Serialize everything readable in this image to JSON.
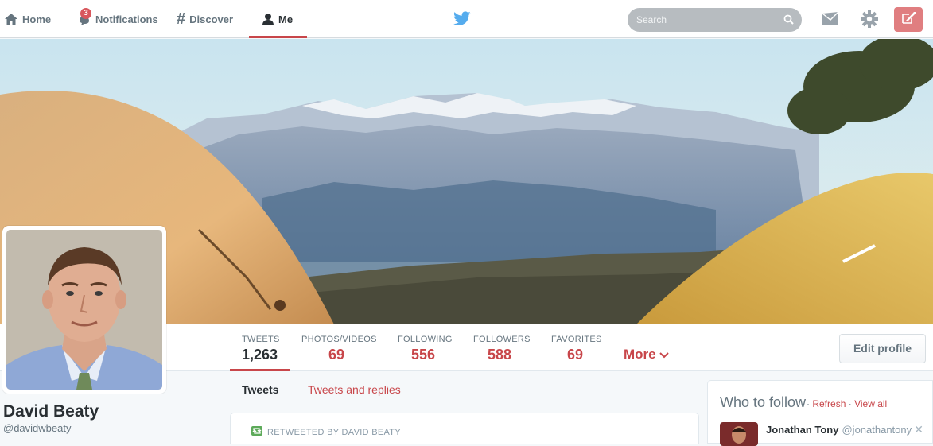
{
  "nav": {
    "home_label": "Home",
    "notifications_label": "Notifications",
    "notifications_count": "3",
    "discover_label": "Discover",
    "me_label": "Me"
  },
  "search": {
    "placeholder": "Search"
  },
  "colors": {
    "accent": "#c8464a",
    "nav_active_underline": "#c8464a",
    "compose_bg": "#e07e80"
  },
  "stats": {
    "tweets": {
      "label": "TWEETS",
      "value": "1,263"
    },
    "photos": {
      "label": "PHOTOS/VIDEOS",
      "value": "69"
    },
    "following": {
      "label": "FOLLOWING",
      "value": "556"
    },
    "followers": {
      "label": "FOLLOWERS",
      "value": "588"
    },
    "favorites": {
      "label": "FAVORITES",
      "value": "69"
    },
    "more_label": "More"
  },
  "edit_profile_label": "Edit profile",
  "profile": {
    "name": "David Beaty",
    "handle": "@davidwbeaty"
  },
  "timeline": {
    "tabs": [
      "Tweets",
      "Tweets and replies"
    ],
    "retweet_context": "RETWEETED BY DAVID BEATY"
  },
  "who_to_follow": {
    "title": "Who to follow",
    "separator": "·",
    "refresh_label": "Refresh",
    "view_all_label": "View all",
    "user": {
      "name": "Jonathan Tony",
      "handle": "@jonathantony"
    },
    "close_glyph": "✕"
  },
  "icons": [
    "home-icon",
    "notifications-icon",
    "discover-hash-icon",
    "me-person-icon",
    "twitter-bird-icon",
    "search-icon",
    "envelope-icon",
    "gear-icon",
    "compose-icon",
    "chevron-down-icon",
    "retweet-icon",
    "close-icon"
  ]
}
